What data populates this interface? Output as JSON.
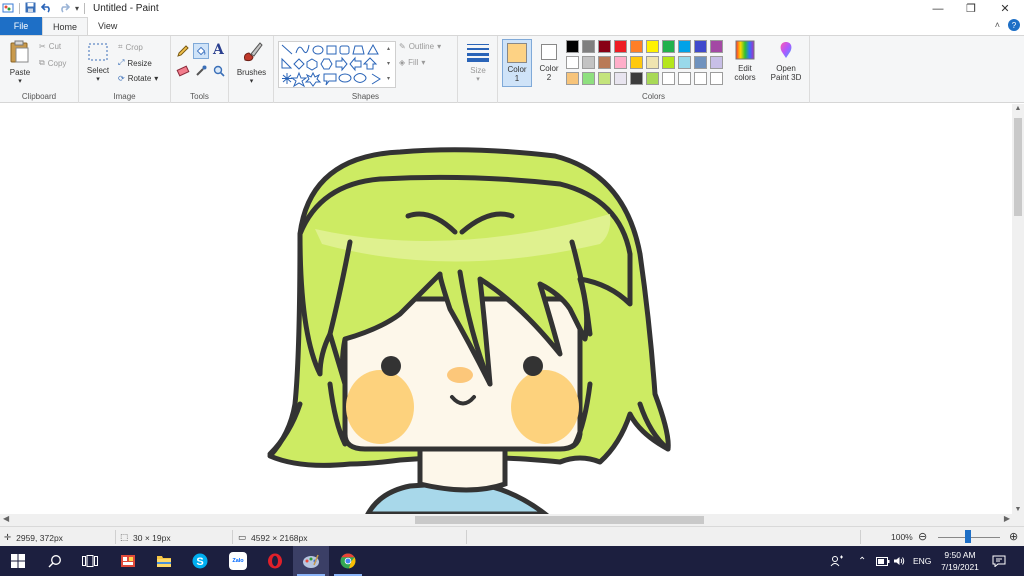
{
  "window": {
    "title": "Untitled - Paint",
    "controls": {
      "minimize": "—",
      "restore": "❐",
      "close": "✕"
    }
  },
  "ribbon_tabs": [
    {
      "label": "File"
    },
    {
      "label": "Home"
    },
    {
      "label": "View"
    }
  ],
  "groups": {
    "clipboard": {
      "label": "Clipboard",
      "paste": "Paste",
      "cut": "Cut",
      "copy": "Copy"
    },
    "image": {
      "label": "Image",
      "select": "Select",
      "crop": "Crop",
      "resize": "Resize",
      "rotate": "Rotate"
    },
    "tools": {
      "label": "Tools"
    },
    "brushes": {
      "label": "Brushes"
    },
    "shapes": {
      "label": "Shapes",
      "outline": "Outline",
      "fill": "Fill"
    },
    "size": {
      "label": "Size"
    },
    "colors": {
      "label": "Colors",
      "color1_label": "Color",
      "color1_num": "1",
      "color2_label": "Color",
      "color2_num": "2",
      "color1_value": "#fdd284",
      "color2_value": "#ffffff",
      "edit_colors_1": "Edit",
      "edit_colors_2": "colors",
      "paint3d_1": "Open",
      "paint3d_2": "Paint 3D",
      "palette_row1": [
        "#000000",
        "#7f7f7f",
        "#880015",
        "#ed1c24",
        "#ff7f27",
        "#fff200",
        "#22b14c",
        "#00a2e8",
        "#3f48cc",
        "#a349a4"
      ],
      "palette_row2": [
        "#ffffff",
        "#c3c3c3",
        "#b97a57",
        "#ffaec9",
        "#ffc90e",
        "#efe4b0",
        "#b5e61d",
        "#99d9ea",
        "#7092be",
        "#c8bfe7"
      ],
      "palette_row3": [
        "#f7c47a",
        "#8fe07f",
        "#c4e47c",
        "#e8e4ef",
        "#3c3c3c",
        "#a8d957",
        "#ffffff",
        "#ffffff",
        "#ffffff",
        "#ffffff"
      ]
    }
  },
  "status": {
    "cursor_pos": "2959, 372px",
    "selection_size": "30 × 19px",
    "image_size": "4592 × 2168px",
    "zoom": "100%"
  },
  "taskbar": {
    "apps": [
      "windows-start",
      "search",
      "task-view",
      "snipping-tool",
      "file-explorer",
      "skype",
      "zalo",
      "opera",
      "paint-running",
      "chrome"
    ],
    "zalo_label": "Zalo",
    "lang": "ENG",
    "time": "9:50 AM",
    "date": "7/19/2021"
  },
  "canvas_art": {
    "description_colors": {
      "hair": "#cdeb63",
      "outline": "#333333",
      "skin": "#fdf7ea",
      "blush": "#fdd27d",
      "shirt": "#a8d8ea"
    }
  }
}
